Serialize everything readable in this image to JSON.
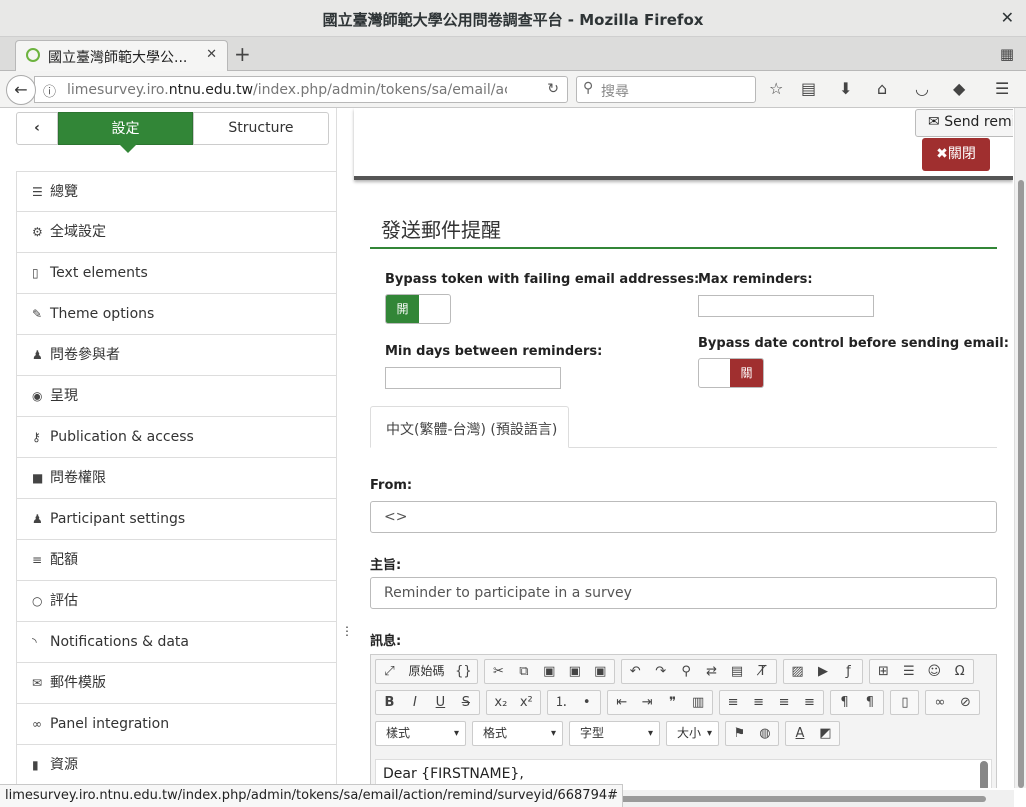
{
  "window": {
    "title": "國立臺灣師範大學公用問卷調查平台 - Mozilla Firefox",
    "close_glyph": "✕"
  },
  "tabs": [
    {
      "label": "國立臺灣師範大學公...",
      "close_glyph": "✕"
    }
  ],
  "navbar": {
    "url_plain": "limesurvey.iro.",
    "url_domain": "ntnu.edu.tw",
    "url_rest": "/index.php/admin/tokens/sa/email/action/r",
    "search_placeholder": "搜尋"
  },
  "sidebar": {
    "back_glyph": "‹",
    "tab_settings": "設定",
    "tab_structure": "Structure",
    "items": [
      {
        "label": "總覽",
        "icon": "list-icon"
      },
      {
        "label": "全域設定",
        "icon": "gears-icon"
      },
      {
        "label": "Text elements",
        "icon": "file-icon"
      },
      {
        "label": "Theme options",
        "icon": "brush-icon"
      },
      {
        "label": "問卷參與者",
        "icon": "user-icon"
      },
      {
        "label": "呈現",
        "icon": "eye-slash-icon"
      },
      {
        "label": "Publication & access",
        "icon": "key-icon"
      },
      {
        "label": "問卷權限",
        "icon": "lock-icon"
      },
      {
        "label": "Participant settings",
        "icon": "users-icon"
      },
      {
        "label": "配額",
        "icon": "tasks-icon"
      },
      {
        "label": "評估",
        "icon": "comment-icon"
      },
      {
        "label": "Notifications & data",
        "icon": "feed-icon"
      },
      {
        "label": "郵件模版",
        "icon": "envelope-icon"
      },
      {
        "label": "Panel integration",
        "icon": "link-icon"
      },
      {
        "label": "資源",
        "icon": "file-icon"
      }
    ]
  },
  "topbar": {
    "send_label": "Send remind",
    "close_label": "關閉"
  },
  "panel": {
    "title": "發送郵件提醒",
    "bypass_token_label": "Bypass token with failing email addresses:",
    "bypass_token_toggle": "開",
    "max_reminders_label": "Max reminders:",
    "max_reminders_value": "",
    "min_days_label": "Min days between reminders:",
    "min_days_value": "",
    "bypass_date_label": "Bypass date control before sending email:",
    "bypass_date_toggle": "關",
    "language_tab": "中文(繁體-台灣) (預設語言)",
    "from_label": "From:",
    "from_value": "<>",
    "subject_label": "主旨:",
    "subject_value": "Reminder to participate in a survey",
    "message_label": "訊息:"
  },
  "editor": {
    "source_label": "原始碼",
    "combos": {
      "styles": "樣式",
      "format": "格式",
      "font": "字型",
      "size": "大小"
    },
    "body_text": "Dear {FIRSTNAME},"
  },
  "statusbar": {
    "text": "limesurvey.iro.ntnu.edu.tw/index.php/admin/tokens/sa/email/action/remind/surveyid/668794#"
  },
  "colors": {
    "accent_green": "#328637",
    "danger_red": "#a02f2f"
  }
}
